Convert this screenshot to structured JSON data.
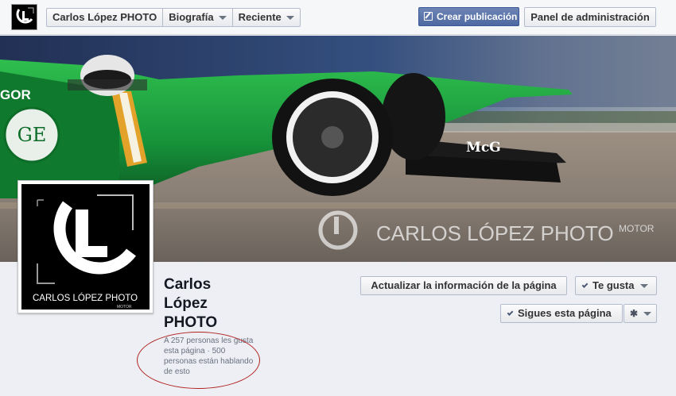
{
  "topbar": {
    "page_tab": "Carlos López PHOTO",
    "biography_tab": "Biografía",
    "recent_tab": "Reciente",
    "create_post": "Crear publicación",
    "admin_panel": "Panel de administración",
    "logo_icon": "brand-logo-icon",
    "create_icon": "pencil-icon"
  },
  "cover": {
    "watermark_brand": "CARLOS LÓPEZ PHOTO",
    "watermark_sub": "MOTOR",
    "car_sponsor_left": "GOR",
    "car_sponsor_nose": "McG",
    "car_ge_logo": "GE"
  },
  "profile": {
    "logo_text": "CARLOS LÓPEZ PHOTO",
    "logo_sub": "MOTOR"
  },
  "page": {
    "name": "Carlos López PHOTO",
    "likes_text": "A 257 personas les gusta esta página",
    "separator": "·",
    "talking_text": "500 personas están hablando de esto"
  },
  "actions": {
    "update_info": "Actualizar la información de la página",
    "like": "Te gusta",
    "follow": "Sigues esta página",
    "settings_icon": "gear-icon"
  },
  "colors": {
    "primary": "#4e69a2",
    "car_green": "#1f9a3c",
    "annotation_oval": "#b0211f"
  }
}
